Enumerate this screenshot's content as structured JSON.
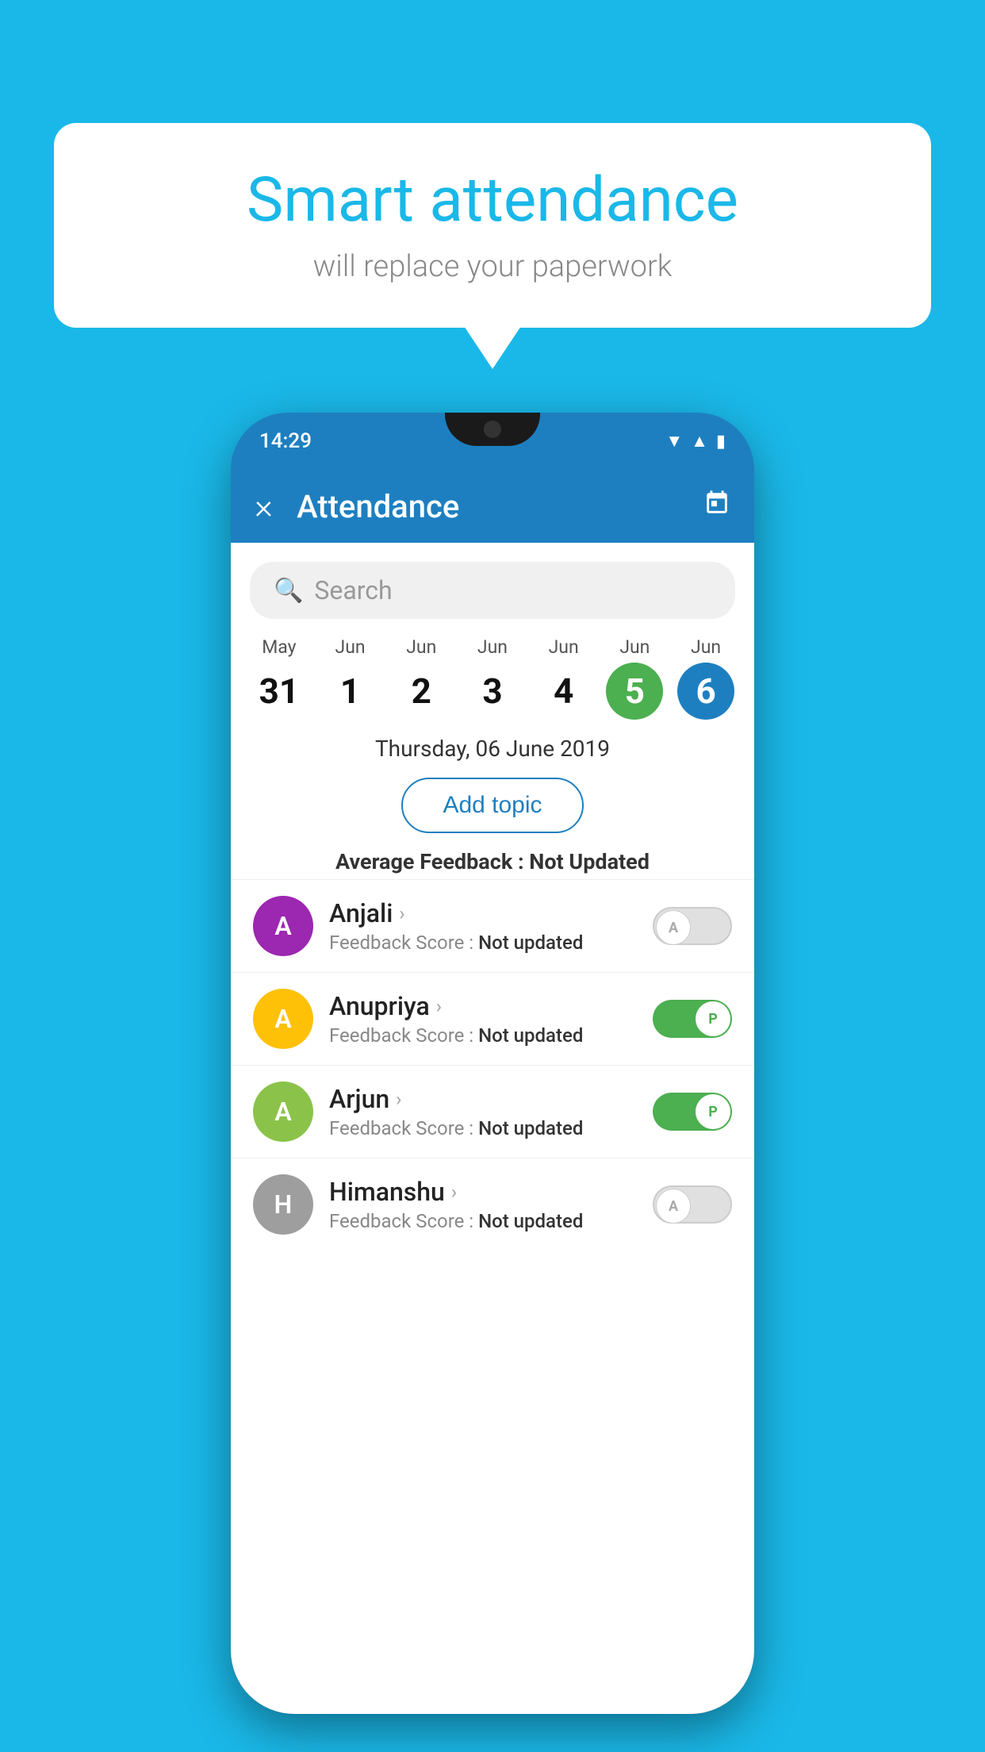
{
  "background_color": "#1ab8e8",
  "speech_bubble": {
    "title": "Smart attendance",
    "subtitle": "will replace your paperwork"
  },
  "phone": {
    "status_bar": {
      "time": "14:29"
    },
    "app_bar": {
      "title": "Attendance",
      "close_label": "×",
      "calendar_icon": "calendar"
    },
    "search": {
      "placeholder": "Search"
    },
    "calendar": {
      "dates": [
        {
          "month": "May",
          "day": "31",
          "style": "normal"
        },
        {
          "month": "Jun",
          "day": "1",
          "style": "normal"
        },
        {
          "month": "Jun",
          "day": "2",
          "style": "normal"
        },
        {
          "month": "Jun",
          "day": "3",
          "style": "normal"
        },
        {
          "month": "Jun",
          "day": "4",
          "style": "normal"
        },
        {
          "month": "Jun",
          "day": "5",
          "style": "green"
        },
        {
          "month": "Jun",
          "day": "6",
          "style": "blue"
        }
      ]
    },
    "selected_date_label": "Thursday, 06 June 2019",
    "add_topic_label": "Add topic",
    "avg_feedback_label": "Average Feedback :",
    "avg_feedback_value": "Not Updated",
    "students": [
      {
        "name": "Anjali",
        "feedback_label": "Feedback Score :",
        "feedback_value": "Not updated",
        "avatar_letter": "A",
        "avatar_color": "#9c27b0",
        "toggle_state": "off",
        "toggle_letter": "A"
      },
      {
        "name": "Anupriya",
        "feedback_label": "Feedback Score :",
        "feedback_value": "Not updated",
        "avatar_letter": "A",
        "avatar_color": "#ffc107",
        "toggle_state": "on",
        "toggle_letter": "P"
      },
      {
        "name": "Arjun",
        "feedback_label": "Feedback Score :",
        "feedback_value": "Not updated",
        "avatar_letter": "A",
        "avatar_color": "#8bc34a",
        "toggle_state": "on",
        "toggle_letter": "P"
      },
      {
        "name": "Himanshu",
        "feedback_label": "Feedback Score :",
        "feedback_value": "Not updated",
        "avatar_letter": "H",
        "avatar_color": "#9e9e9e",
        "toggle_state": "off",
        "toggle_letter": "A"
      }
    ]
  }
}
